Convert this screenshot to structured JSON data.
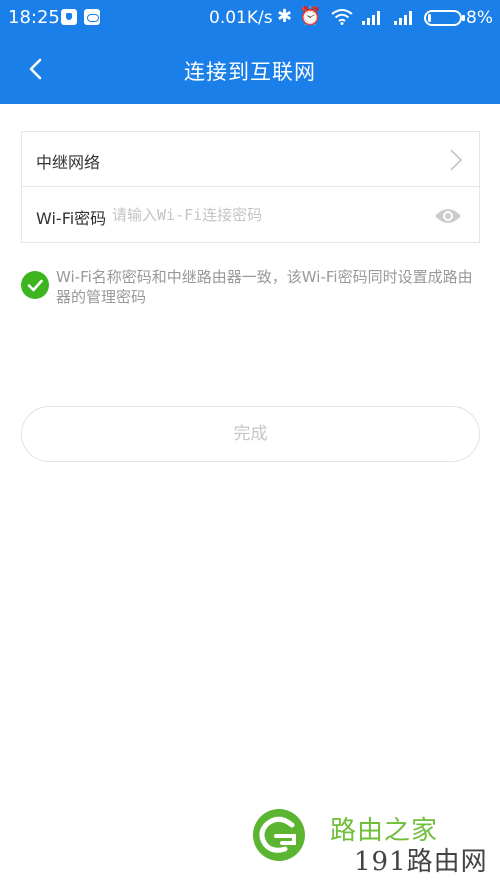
{
  "status_bar": {
    "time": "18:25",
    "network_speed": "0.01K/s",
    "battery_percent": "8%",
    "battery_level": 0.08,
    "icons": [
      "shield-app-icon",
      "cloud-app-icon",
      "bluetooth-icon",
      "alarm-icon",
      "wifi-icon",
      "signal-icon",
      "signal-icon",
      "battery-icon"
    ]
  },
  "app_bar": {
    "title": "连接到互联网",
    "back_icon": "chevron-left-icon",
    "color": "#1a7fe8"
  },
  "form": {
    "relay_network_label": "中继网络",
    "relay_network_value": "",
    "wifi_password_label": "Wi-Fi密码",
    "wifi_password_value": "",
    "wifi_password_placeholder": "请输入Wi-Fi连接密码"
  },
  "sync_option": {
    "checked": true,
    "text": "Wi-Fi名称密码和中继路由器一致，该Wi-Fi密码同时设置成路由器的管理密码",
    "color": "#3cb521"
  },
  "done_button": {
    "label": "完成",
    "enabled": false
  },
  "watermark": {
    "line1": "路由之家",
    "line2": "191路由网"
  }
}
